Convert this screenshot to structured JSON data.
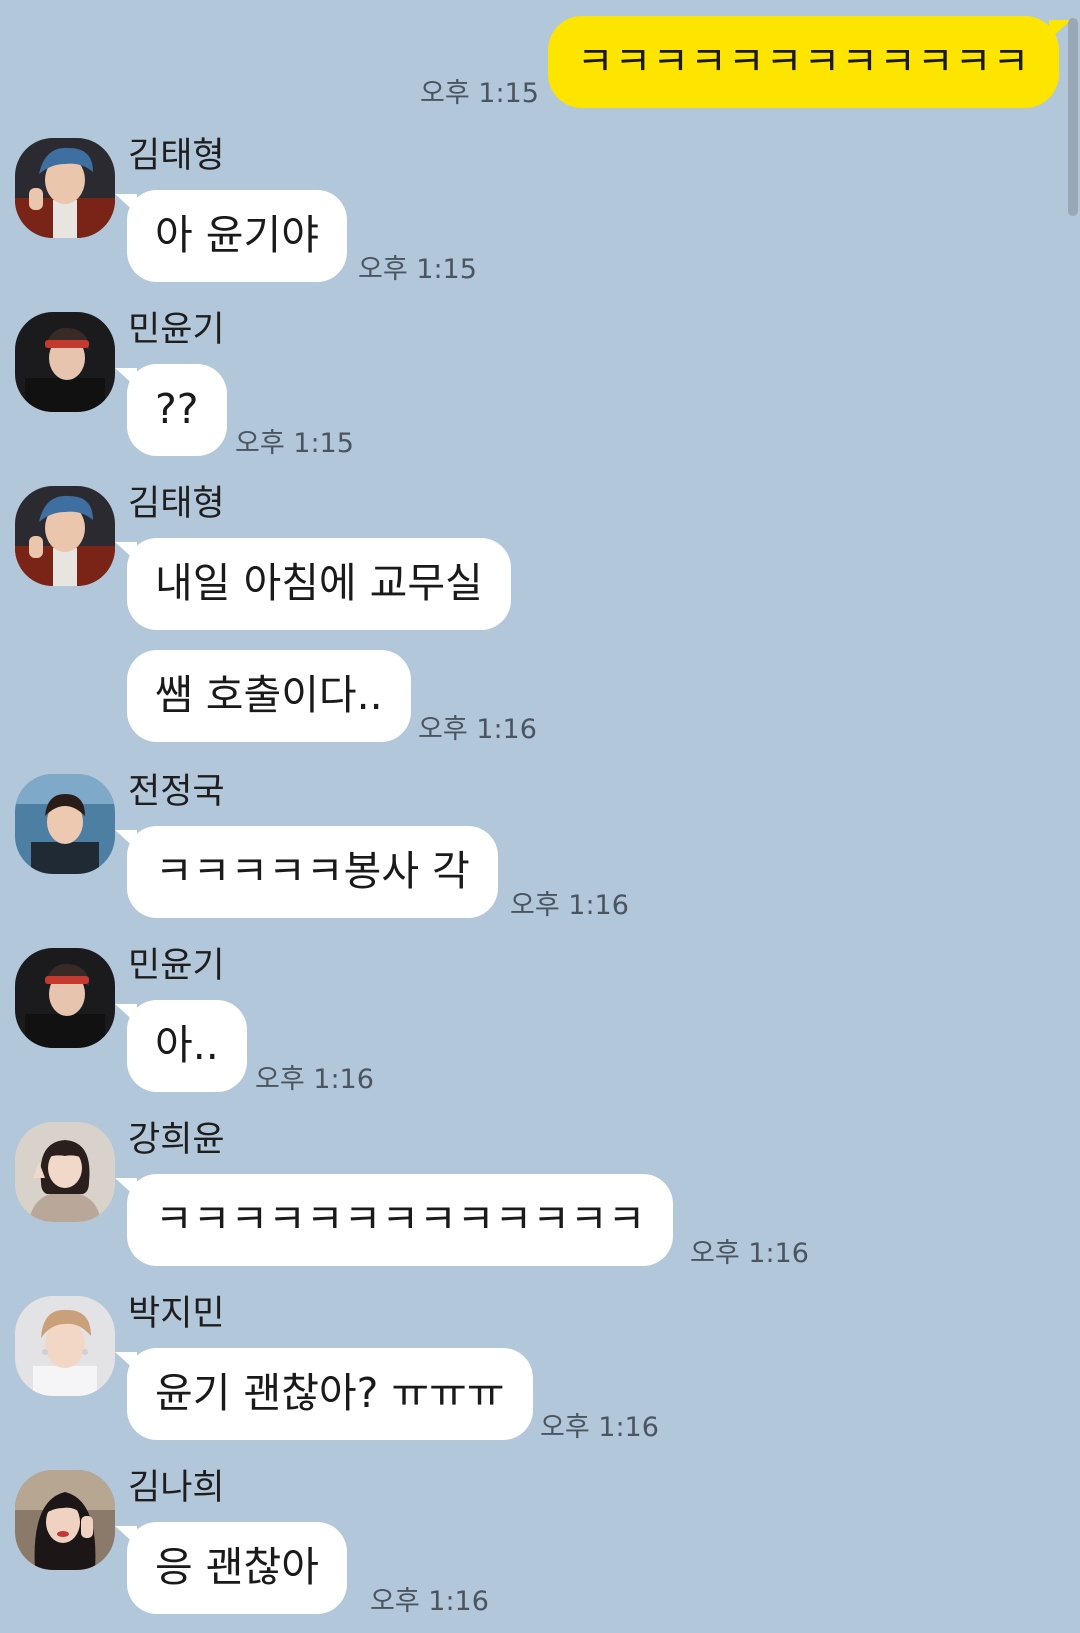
{
  "app": {
    "colors": {
      "background": "#b2c7da",
      "my_bubble": "#fee500",
      "their_bubble": "#ffffff"
    }
  },
  "chat": {
    "my_message": {
      "text": "ㅋㅋㅋㅋㅋㅋㅋㅋㅋㅋㅋㅋ",
      "time": "오후 1:15"
    },
    "messages": [
      {
        "sender": "김태형",
        "avatar": "taehyung-avatar",
        "bubbles": [
          "아 윤기야"
        ],
        "time": "오후 1:15"
      },
      {
        "sender": "민윤기",
        "avatar": "yoongi-avatar",
        "bubbles": [
          "??"
        ],
        "time": "오후 1:15"
      },
      {
        "sender": "김태형",
        "avatar": "taehyung-avatar",
        "bubbles": [
          "내일 아침에 교무실",
          "쌤 호출이다.."
        ],
        "time": "오후 1:16"
      },
      {
        "sender": "전정국",
        "avatar": "jungkook-avatar",
        "bubbles": [
          "ㅋㅋㅋㅋㅋ봉사 각"
        ],
        "time": "오후 1:16"
      },
      {
        "sender": "민윤기",
        "avatar": "yoongi-avatar",
        "bubbles": [
          "아.."
        ],
        "time": "오후 1:16"
      },
      {
        "sender": "강희윤",
        "avatar": "heeyoon-avatar",
        "bubbles": [
          "ㅋㅋㅋㅋㅋㅋㅋㅋㅋㅋㅋㅋㅋ"
        ],
        "time": "오후 1:16"
      },
      {
        "sender": "박지민",
        "avatar": "jimin-avatar",
        "bubbles": [
          "윤기 괜찮아? ㅠㅠㅠ"
        ],
        "time": "오후 1:16"
      },
      {
        "sender": "김나희",
        "avatar": "nahee-avatar",
        "bubbles": [
          "응 괜찮아"
        ],
        "time": "오후 1:16"
      }
    ]
  }
}
